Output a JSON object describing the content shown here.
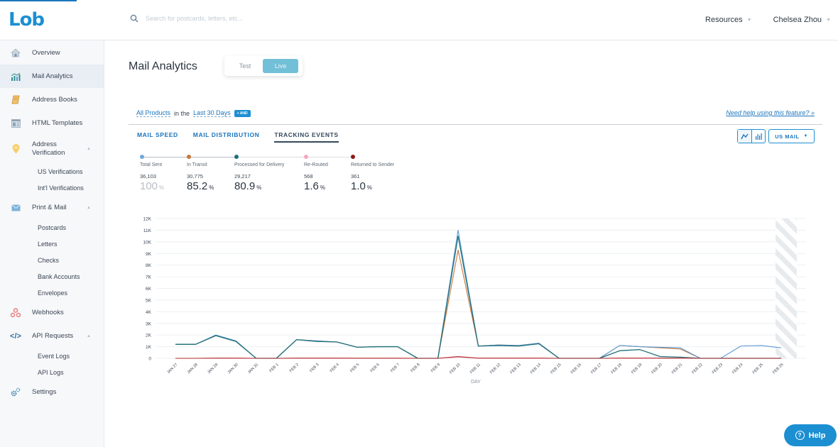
{
  "app": {
    "logo": "Lob",
    "search_placeholder": "Search for postcards, letters, etc...",
    "resources_label": "Resources",
    "user_name": "Chelsea Zhou"
  },
  "sidebar": {
    "items": [
      {
        "label": "Overview",
        "icon": "home-icon"
      },
      {
        "label": "Mail Analytics",
        "icon": "analytics-icon",
        "active": true
      },
      {
        "label": "Address Books",
        "icon": "address-book-icon"
      },
      {
        "label": "HTML Templates",
        "icon": "template-icon"
      },
      {
        "label": "Address Verification",
        "icon": "location-pin-icon",
        "sub": [
          "US Verifications",
          "Int'l Verifications"
        ]
      },
      {
        "label": "Print & Mail",
        "icon": "envelope-icon",
        "sub": [
          "Postcards",
          "Letters",
          "Checks",
          "Bank Accounts",
          "Envelopes"
        ]
      },
      {
        "label": "Webhooks",
        "icon": "webhook-icon"
      },
      {
        "label": "API Requests",
        "icon": "code-icon",
        "sub": [
          "Event Logs",
          "API Logs"
        ]
      },
      {
        "label": "Settings",
        "icon": "gear-icon"
      }
    ]
  },
  "main": {
    "title": "Mail Analytics",
    "env": {
      "test": "Test",
      "live": "Live",
      "selected": "Live"
    },
    "filters": {
      "product": "All Products",
      "connector": "in the",
      "range": "Last 30 Days",
      "and_label": "+ AND"
    },
    "help_link": "Need help using this feature? »",
    "tabs": [
      "MAIL SPEED",
      "MAIL DISTRIBUTION",
      "TRACKING EVENTS"
    ],
    "active_tab": "TRACKING EVENTS",
    "mail_type": "US MAIL",
    "stages": [
      {
        "label": "Total Sent",
        "count": "36,103",
        "pct": "100",
        "color": "#6fa8dc"
      },
      {
        "label": "In Transit",
        "count": "30,775",
        "pct": "85.2",
        "color": "#c9773a"
      },
      {
        "label": "Processed for Delivery",
        "count": "29,217",
        "pct": "80.9",
        "color": "#1f6f78"
      },
      {
        "label": "Re-Routed",
        "count": "568",
        "pct": "1.6",
        "color": "#f2a7c3"
      },
      {
        "label": "Returned to Sender",
        "count": "361",
        "pct": "1.0",
        "color": "#8b1a1a"
      }
    ],
    "pct_sign": "%"
  },
  "help_button": "Help",
  "chart_data": {
    "type": "line",
    "title": "",
    "xlabel": "DAY",
    "ylabel": "",
    "ylim": [
      0,
      12000
    ],
    "yticks": [
      "0",
      "1K",
      "2K",
      "3K",
      "4K",
      "5K",
      "6K",
      "7K",
      "8K",
      "9K",
      "10K",
      "11K",
      "12K"
    ],
    "grid": true,
    "categories": [
      "JAN 27",
      "JAN 28",
      "JAN 29",
      "JAN 30",
      "JAN 31",
      "FEB 1",
      "FEB 2",
      "FEB 3",
      "FEB 4",
      "FEB 5",
      "FEB 6",
      "FEB 7",
      "FEB 8",
      "FEB 9",
      "FEB 10",
      "FEB 11",
      "FEB 12",
      "FEB 13",
      "FEB 14",
      "FEB 15",
      "FEB 16",
      "FEB 17",
      "FEB 18",
      "FEB 19",
      "FEB 20",
      "FEB 21",
      "FEB 22",
      "FEB 23",
      "FEB 24",
      "FEB 25",
      "FEB 26"
    ],
    "incomplete_period_from": "FEB 26",
    "series": [
      {
        "name": "Total Sent",
        "color": "#5b9bd5",
        "values": [
          1200,
          1200,
          2000,
          1500,
          0,
          0,
          1600,
          1500,
          1400,
          950,
          1000,
          1000,
          0,
          0,
          11000,
          1050,
          1150,
          1100,
          1300,
          0,
          0,
          0,
          1100,
          1000,
          950,
          900,
          0,
          0,
          1050,
          1100,
          900
        ]
      },
      {
        "name": "In Transit",
        "color": "#c9773a",
        "values": [
          1200,
          1200,
          1950,
          1450,
          0,
          0,
          1600,
          1500,
          1400,
          950,
          1000,
          1000,
          0,
          0,
          9300,
          1050,
          1150,
          1100,
          1300,
          0,
          0,
          0,
          1100,
          1000,
          900,
          800,
          0,
          0,
          0,
          0,
          0
        ]
      },
      {
        "name": "Processed for Delivery",
        "color": "#1f6f78",
        "values": [
          1200,
          1200,
          1950,
          1450,
          0,
          0,
          1600,
          1450,
          1400,
          950,
          1000,
          1000,
          0,
          0,
          10500,
          1050,
          1100,
          1050,
          1250,
          0,
          0,
          0,
          650,
          750,
          150,
          100,
          0,
          0,
          0,
          0,
          0
        ]
      },
      {
        "name": "Re-Routed",
        "color": "#f2a7c3",
        "values": [
          0,
          0,
          20,
          20,
          0,
          0,
          20,
          20,
          20,
          10,
          10,
          10,
          0,
          0,
          100,
          20,
          20,
          20,
          20,
          0,
          0,
          0,
          20,
          20,
          20,
          20,
          0,
          0,
          0,
          0,
          0
        ]
      },
      {
        "name": "Returned to Sender",
        "color": "#b22a2a",
        "values": [
          0,
          0,
          10,
          10,
          0,
          0,
          10,
          10,
          10,
          5,
          5,
          5,
          0,
          0,
          150,
          10,
          10,
          10,
          10,
          0,
          0,
          0,
          10,
          10,
          10,
          10,
          0,
          0,
          0,
          0,
          0
        ]
      }
    ]
  }
}
